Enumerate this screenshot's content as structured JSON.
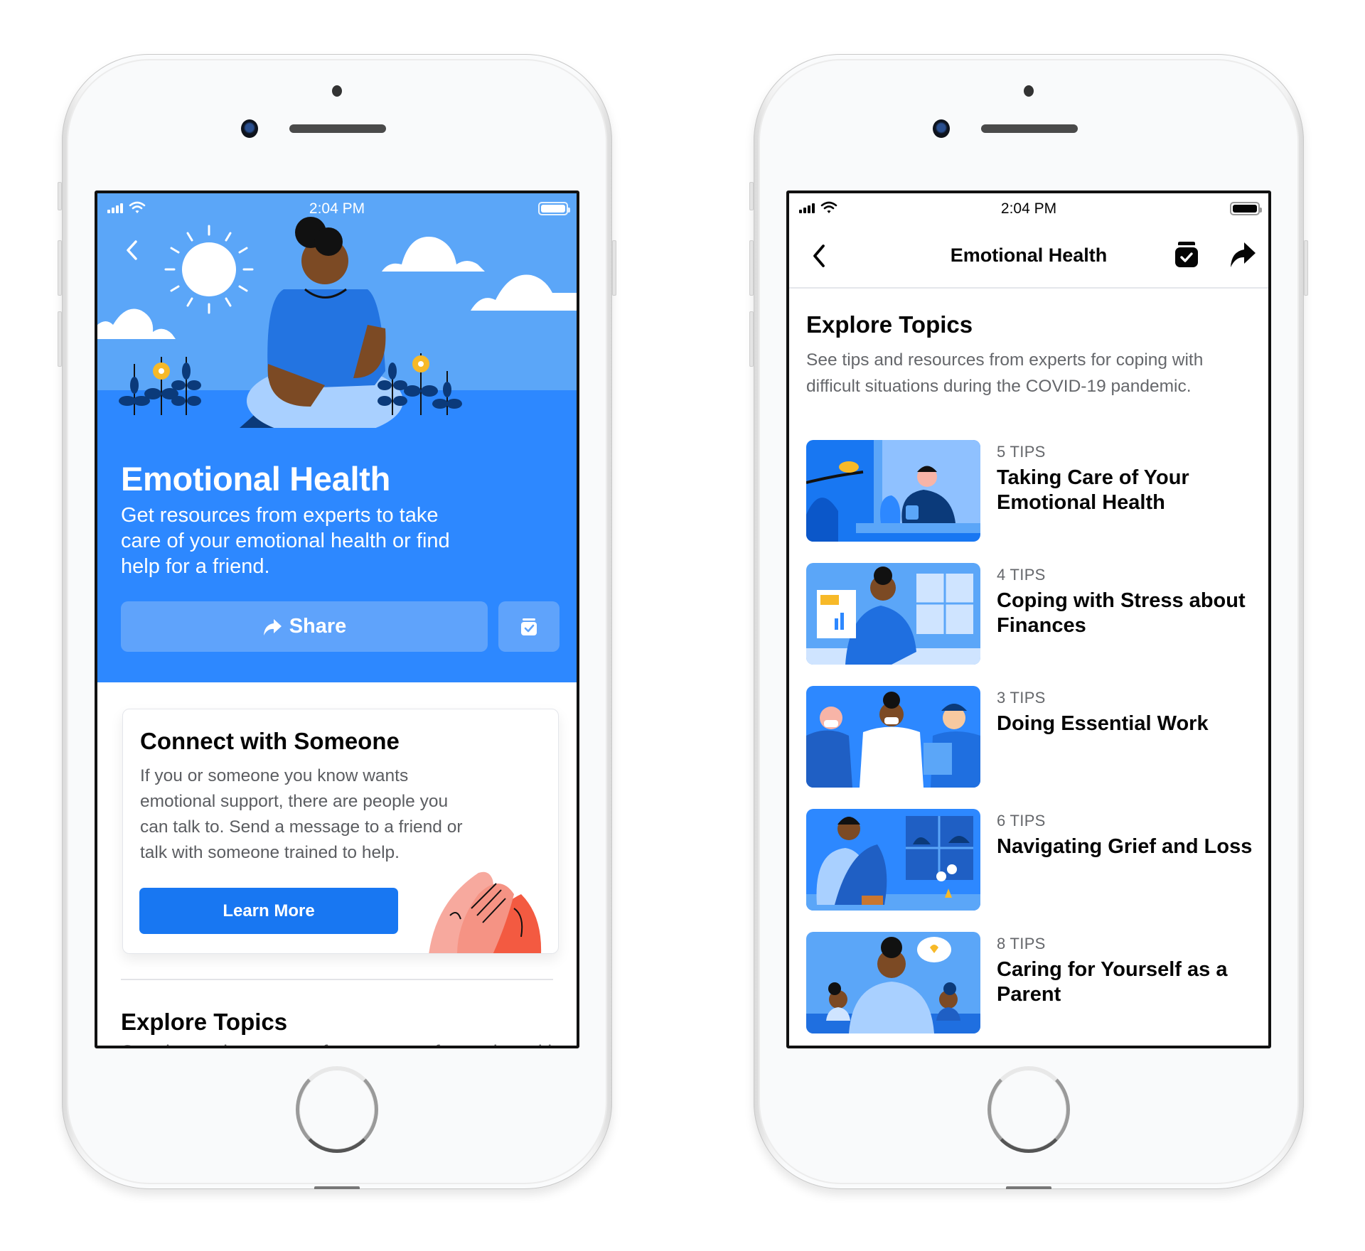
{
  "status_bar": {
    "time": "2:04 PM"
  },
  "colors": {
    "brand_blue": "#1877f2",
    "hero_blue": "#2d88ff",
    "sky_blue": "#5ba6f8",
    "button_tint": "#5fa3fb",
    "text_primary": "#050505",
    "text_secondary": "#65676b"
  },
  "left_screen": {
    "hero": {
      "back_icon": "chevron-left-icon",
      "title": "Emotional Health",
      "description": "Get resources from experts to take care of your emotional health or find help for a friend.",
      "share_label": "Share",
      "share_icon": "share-arrow-icon",
      "save_icon": "save-bookmark-icon"
    },
    "connect_card": {
      "title": "Connect with Someone",
      "body": "If you or someone you know wants emotional support, there are people you can talk to. Send a message to a friend or talk with someone trained to help.",
      "button_label": "Learn More"
    },
    "explore": {
      "title": "Explore Topics",
      "description": "See tips and resources from experts for coping with difficult situations during the COVID-19 pandemic."
    }
  },
  "right_screen": {
    "nav": {
      "title": "Emotional Health",
      "back_icon": "chevron-left-icon",
      "save_icon": "save-bookmark-icon",
      "share_icon": "share-arrow-icon"
    },
    "explore": {
      "title": "Explore Topics",
      "description": "See tips and resources from experts for coping with difficult situations during the COVID-19 pandemic."
    },
    "topics": [
      {
        "count": "5 TIPS",
        "title": "Taking Care of Your Emotional Health",
        "thumb": "window-person-with-cat"
      },
      {
        "count": "4 TIPS",
        "title": "Coping with Stress about Finances",
        "thumb": "person-with-bills"
      },
      {
        "count": "3 TIPS",
        "title": "Doing Essential Work",
        "thumb": "essential-workers"
      },
      {
        "count": "6 TIPS",
        "title": "Navigating Grief and Loss",
        "thumb": "person-sitting-by-window"
      },
      {
        "count": "8 TIPS",
        "title": "Caring for Yourself as a Parent",
        "thumb": "parent-with-children"
      }
    ]
  }
}
